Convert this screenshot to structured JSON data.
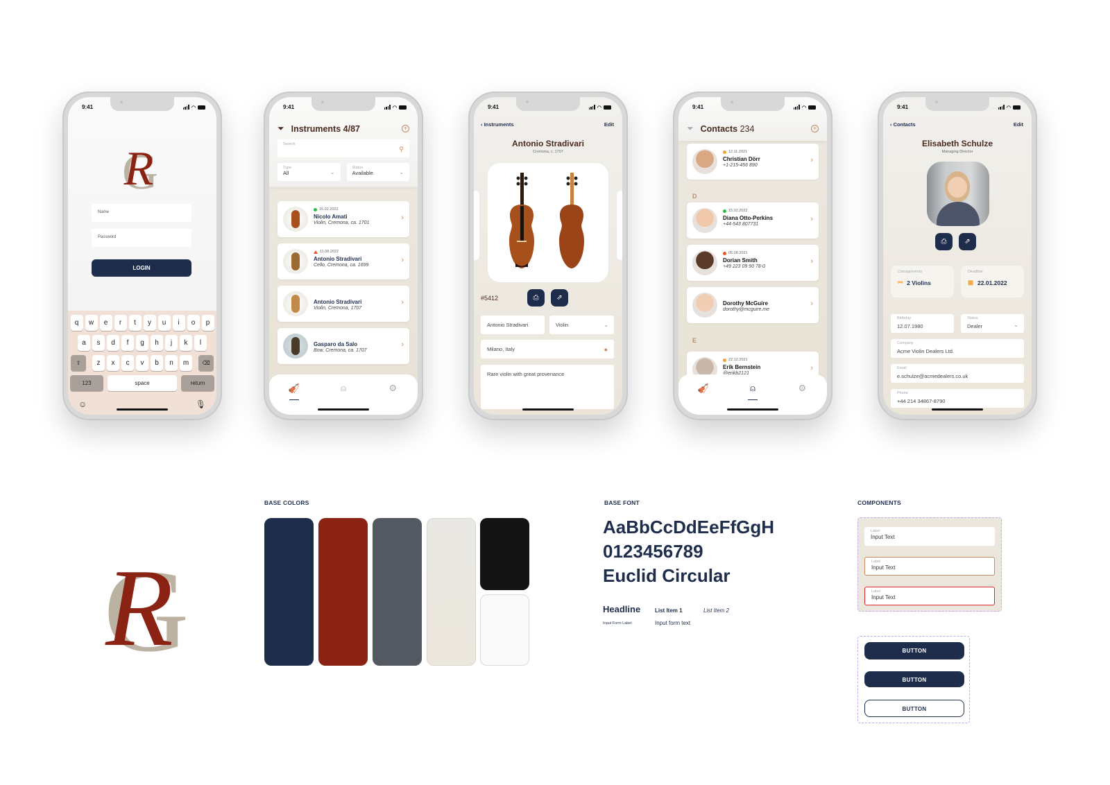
{
  "status_time": "9:41",
  "login": {
    "logo_letters": [
      "R",
      "G"
    ],
    "name_placeholder": "Name",
    "password_placeholder": "Password",
    "login_label": "LOGIN",
    "keyboard": {
      "row1": [
        "q",
        "w",
        "e",
        "r",
        "t",
        "y",
        "u",
        "i",
        "o",
        "p"
      ],
      "row2": [
        "a",
        "s",
        "d",
        "f",
        "g",
        "h",
        "j",
        "k",
        "l"
      ],
      "row3": [
        "z",
        "x",
        "c",
        "v",
        "b",
        "n",
        "m"
      ],
      "numbers_label": "123",
      "space_label": "space",
      "return_label": "return"
    }
  },
  "instruments": {
    "title": "Instruments",
    "count": "4/87",
    "search_label": "Search",
    "type_label": "Type",
    "type_value": "All",
    "status_label": "Status",
    "status_value": "Available",
    "items": [
      {
        "date": "15.02.2022",
        "status": "green",
        "name": "Nicolo Amati",
        "sub": "Violin, Cremona, ca. 1701"
      },
      {
        "date": "11.08.2022",
        "status": "warning",
        "name": "Antonio Stradivari",
        "sub": "Cello, Cremona, ca. 1699"
      },
      {
        "date": "",
        "status": "",
        "name": "Antonio Stradivari",
        "sub": "Violin, Cremona, 1707"
      },
      {
        "date": "",
        "status": "",
        "name": "Gasparo da Salo",
        "sub": "Bow, Cremona, ca. 1707"
      }
    ]
  },
  "instrument_detail": {
    "back_label": "Instruments",
    "edit_label": "Edit",
    "title": "Antonio Stradivari",
    "subtitle": "Cremona, c. 1707",
    "number": "#5412",
    "maker_value": "Antonio Stradivari",
    "type_value": "Violin",
    "location_value": "Milano, Italy",
    "notes_value": "Rare violin with great provenance"
  },
  "contacts": {
    "title": "Contacts",
    "count": "234",
    "sections": [
      "D",
      "E"
    ],
    "items": [
      {
        "date": "12.11.2021",
        "status": "orange",
        "name": "Christian Dörr",
        "sub": "+1-215-456 890"
      },
      {
        "date": "15.02.2022",
        "status": "green",
        "name": "Diana Otto-Perkins",
        "sub": "+44-543 807731"
      },
      {
        "date": "05.08.2021",
        "status": "red",
        "name": "Dorian Smith",
        "sub": "+49 223 09 90 78-0"
      },
      {
        "date": "",
        "status": "",
        "name": "Dorothy McGuire",
        "sub": "dorothy@mcguire.me"
      },
      {
        "date": "22.12.2021",
        "status": "orange",
        "name": "Erik Bernstein",
        "sub": "@erikb2121"
      }
    ]
  },
  "contact_detail": {
    "back_label": "Contacts",
    "edit_label": "Edit",
    "name": "Elisabeth Schulze",
    "role": "Managing Director",
    "consignments_label": "Consignments",
    "consignments_value": "2 Violins",
    "deadline_label": "Deadline",
    "deadline_value": "22.01.2022",
    "birthday_label": "Birthday",
    "birthday_value": "12.07.1980",
    "status_label": "Status",
    "status_value": "Dealer",
    "company_label": "Company",
    "company_value": "Acme Violin Dealers Ltd.",
    "email_label": "Email",
    "email_value": "e.schulze@acmedealers.co.uk",
    "phone_label": "Phone",
    "phone_value": "+44 214 34867-8790"
  },
  "style_guide": {
    "base_colors_title": "BASE COLORS",
    "colors": {
      "navy": "#1f2d4d",
      "red": "#8a2313",
      "gray": "#535861",
      "cream": "#ece7dc",
      "black": "#141414",
      "white": "#fafafa"
    },
    "base_font_title": "BASE FONT",
    "font_sample_1": "AaBbCcDdEeFfGgH",
    "font_sample_2": "0123456789",
    "font_name": "Euclid Circular",
    "headline": "Headline",
    "list_item_1": "List Item 1",
    "list_item_2": "List Item 2",
    "input_form_label": "Input Form Label",
    "input_form_text": "Input form text",
    "components_title": "COMPONENTS",
    "input_label": "Label",
    "input_text": "Input Text",
    "button_label": "BUTTON",
    "accent": "#c48a63",
    "error": "#d7262b"
  }
}
